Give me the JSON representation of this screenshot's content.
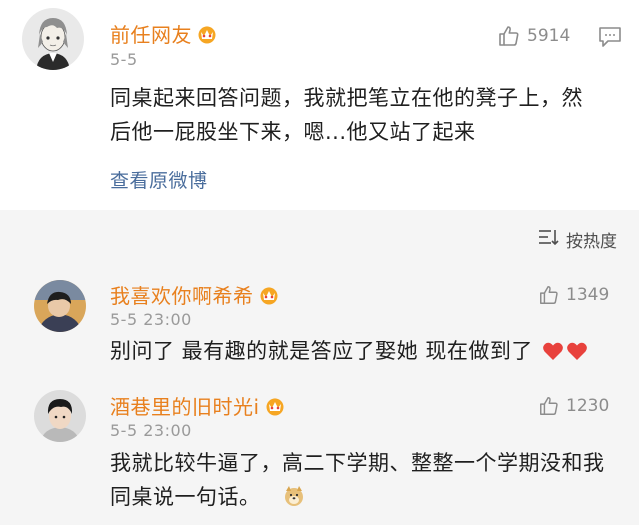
{
  "post": {
    "username": "前任网友",
    "time": "5-5",
    "like_count": "5914",
    "content_line1": "同桌起来回答问题，我就把笔立在他的凳子上，然",
    "content_line2": "后他一屁股坐下来，嗯...他又站了起来",
    "view_original": "查看原微博"
  },
  "sort": {
    "label": "按热度",
    "icon": "sort-lines-icon"
  },
  "replies": [
    {
      "username": "我喜欢你啊希希",
      "time": "5-5 23:00",
      "like_count": "1349",
      "content": "别问了 最有趣的就是答应了娶她 现在做到了"
    },
    {
      "username": "酒巷里的旧时光i",
      "time": "5-5 23:00",
      "like_count": "1230",
      "content_line1": "我就比较牛逼了，高二下学期、整整一个学期没和我",
      "content_line2": "同桌说一句话。"
    }
  ],
  "colors": {
    "username": "#e8801e",
    "link": "#4a6d9c",
    "meta": "#9a9a9a",
    "text": "#1f1f1f",
    "heart": "#e8413c",
    "grey_bg": "#f5f5f5"
  }
}
